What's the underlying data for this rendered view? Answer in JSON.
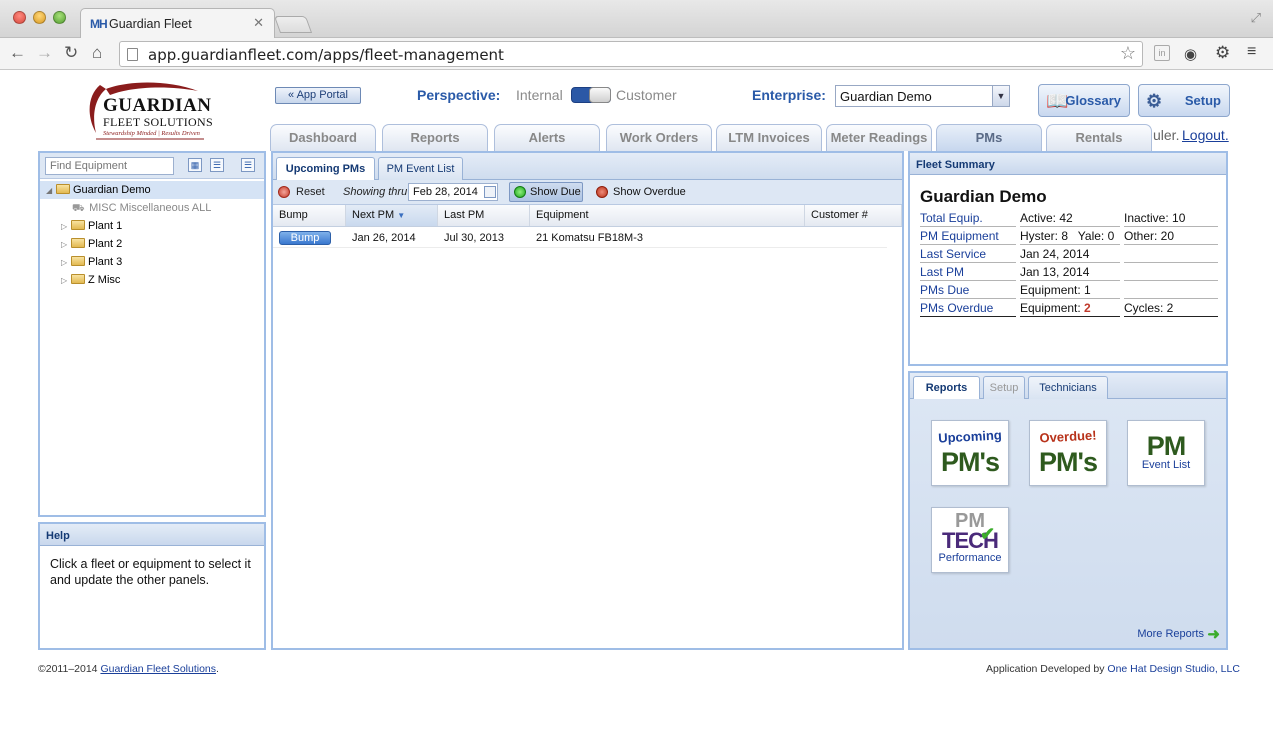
{
  "browser": {
    "tab_logo": "MH",
    "tab_title": "Guardian Fleet",
    "url": "app.guardianfleet.com/apps/fleet-management"
  },
  "header": {
    "logo_name": "GUARDIAN",
    "logo_sub": "FLEET SOLUTIONS",
    "logo_tagline": "Stewardship Minded | Results Driven",
    "app_portal": "« App Portal",
    "perspective_label": "Perspective:",
    "perspective_internal": "Internal",
    "perspective_customer": "Customer",
    "enterprise_label": "Enterprise:",
    "enterprise_value": "Guardian Demo",
    "glossary": "Glossary",
    "setup": "Setup",
    "user_tail": "uler.",
    "logout": "Logout."
  },
  "tabs": [
    {
      "label": "Dashboard"
    },
    {
      "label": "Reports"
    },
    {
      "label": "Alerts"
    },
    {
      "label": "Work Orders"
    },
    {
      "label": "LTM Invoices"
    },
    {
      "label": "Meter Readings"
    },
    {
      "label": "PMs"
    },
    {
      "label": "Rentals"
    }
  ],
  "tree": {
    "search_placeholder": "Find Equipment",
    "items": [
      {
        "label": "Guardian Demo"
      },
      {
        "label": "MISC Miscellaneous ALL"
      },
      {
        "label": "Plant 1"
      },
      {
        "label": "Plant 2"
      },
      {
        "label": "Plant 3"
      },
      {
        "label": "Z Misc"
      }
    ]
  },
  "help": {
    "title": "Help",
    "text": "Click a fleet or equipment to select it and update the other panels."
  },
  "pms": {
    "tab_upcoming": "Upcoming PMs",
    "tab_event": "PM Event List",
    "reset": "Reset",
    "showing_thru": "Showing thru",
    "date": "Feb 28, 2014",
    "show_due": "Show Due",
    "show_overdue": "Show Overdue",
    "columns": [
      "Bump",
      "Next PM",
      "Last PM",
      "Equipment",
      "Customer #"
    ],
    "rows": [
      {
        "bump": "Bump",
        "next_pm": "Jan 26, 2014",
        "last_pm": "Jul 30, 2013",
        "equipment": "21 Komatsu FB18M-3",
        "customer": ""
      }
    ]
  },
  "fleet_summary": {
    "title": "Fleet Summary",
    "name": "Guardian Demo",
    "rows": [
      {
        "label": "Total Equip.",
        "c1": "Active: 42",
        "c2": "Inactive: 10"
      },
      {
        "label": "PM Equipment",
        "c1": "Hyster: 8   Yale: 0",
        "c2": "Other: 20"
      },
      {
        "label": "Last Service",
        "c1": "Jan 24, 2014",
        "c2": ""
      },
      {
        "label": "Last PM",
        "c1": "Jan 13, 2014",
        "c2": ""
      },
      {
        "label": "PMs Due",
        "c1": "Equipment: 1",
        "c2": ""
      },
      {
        "label": "PMs Overdue",
        "c1": "Equipment: ",
        "c1_emph": "2",
        "c2": "Cycles: 2"
      }
    ]
  },
  "reports": {
    "tab_reports": "Reports",
    "tab_setup": "Setup",
    "tab_technicians": "Technicians",
    "tiles": [
      {
        "top": "Upcoming",
        "big": "PM's",
        "small": ""
      },
      {
        "top": "Overdue!",
        "big": "PM's",
        "small": ""
      },
      {
        "top": "",
        "big": "PM",
        "small": "Event List"
      },
      {
        "top": "PM",
        "big": "TECH",
        "small": "Performance"
      }
    ],
    "more": "More Reports"
  },
  "footer": {
    "left_prefix": "©2011–2014 ",
    "left_link": "Guardian Fleet Solutions",
    "left_suffix": ".",
    "right_prefix": "Application Developed by ",
    "right_link": "One Hat Design Studio, LLC"
  },
  "colors": {
    "brand_blue": "#2a5aa8",
    "panel_border": "#9fbde6",
    "logo_red": "#8a1c1c",
    "overdue_red": "#c0392b",
    "due_green": "#1da51e"
  }
}
